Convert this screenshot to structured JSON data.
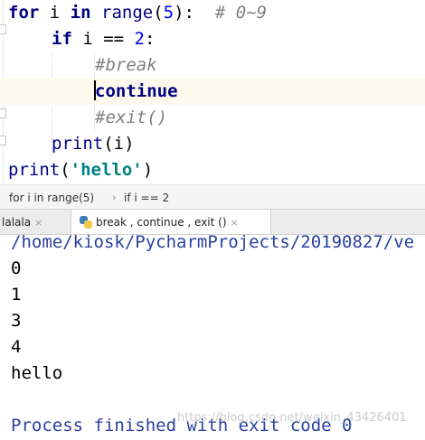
{
  "editor": {
    "lines": [
      {
        "t1": "for",
        "t2": " i ",
        "t3": "in",
        "t4": " ",
        "t5": "range",
        "t6": "(",
        "t7": "5",
        "t8": "):  ",
        "t9": "# 0~9"
      },
      {
        "t1": "if",
        "t2": " i == ",
        "t3": "2",
        "t4": ":"
      },
      {
        "t1": "#break"
      },
      {
        "t1": "continue"
      },
      {
        "t1": "#exit()"
      },
      {
        "t1": "print",
        "t2": "(i)"
      },
      {
        "t1": "print",
        "t2": "(",
        "t3": "'hello'",
        "t4": ")"
      }
    ]
  },
  "breadcrumb": {
    "items": [
      "for i in range(5)",
      "if i == 2"
    ],
    "separator": "›"
  },
  "run_tabs": [
    {
      "label": "lalala",
      "close": "×"
    },
    {
      "label": "break , continue , exit  ()",
      "close": "×"
    }
  ],
  "console": {
    "path": "/home/kiosk/PycharmProjects/20190827/ve",
    "outputs": [
      "0",
      "1",
      "3",
      "4",
      "hello"
    ],
    "process": "Process finished with exit code 0",
    "watermark": "https://blog.csdn.net/weixin_43426401"
  }
}
